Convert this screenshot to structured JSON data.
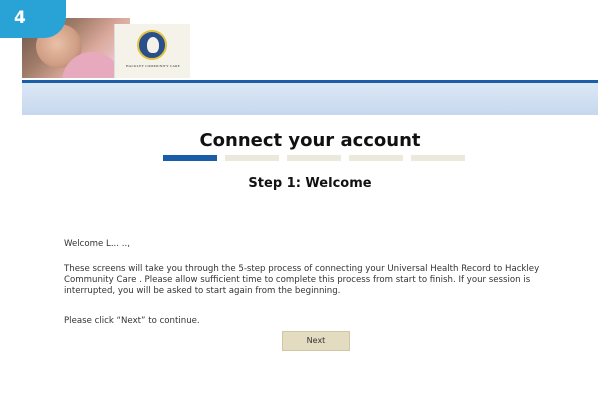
{
  "badge": {
    "number": "4"
  },
  "brand": {
    "logo_text": "HACKLEY COMMUNITY CARE"
  },
  "page": {
    "title": "Connect your account",
    "progress": {
      "total_steps": 5,
      "current_step": 1
    },
    "step_title": "Step 1: Welcome",
    "welcome": "Welcome L... ..,",
    "intro": "These screens will take you through the 5-step process of connecting your Universal Health Record to Hackley Community Care . Please allow sufficient time to complete this process from start to finish. If your session is interrupted, you will be asked to start again from the beginning.",
    "continue_note": "Please click “Next” to continue.",
    "next_label": "Next"
  },
  "colors": {
    "badge": "#29a3d6",
    "accent_blue": "#1a5ea8",
    "progress_inactive": "#ebe8dc",
    "button_bg": "#e3dcc0"
  }
}
